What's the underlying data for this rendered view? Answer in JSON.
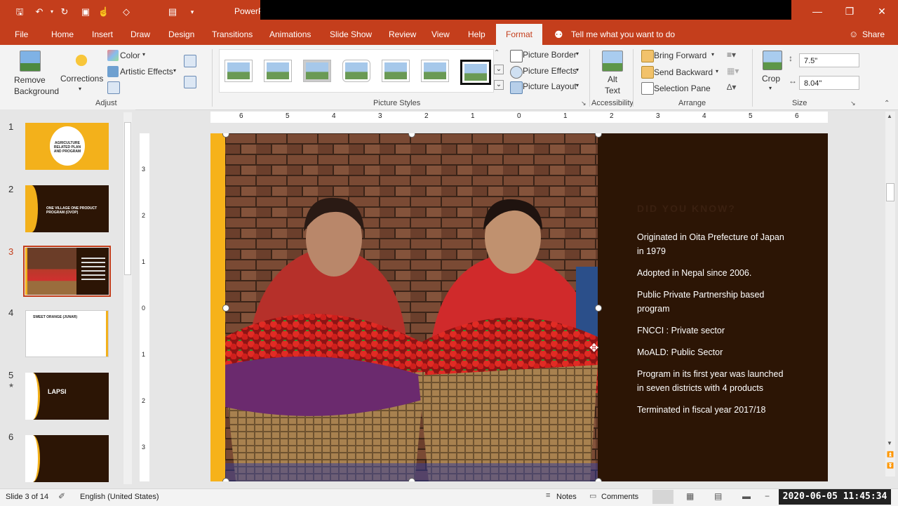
{
  "app": {
    "title": "PowerP"
  },
  "tabs": [
    "File",
    "Home",
    "Insert",
    "Draw",
    "Design",
    "Transitions",
    "Animations",
    "Slide Show",
    "Review",
    "View",
    "Help",
    "Format"
  ],
  "tell_me": "Tell me what you want to do",
  "share": "Share",
  "ribbon": {
    "remove_background": "Remove Background",
    "corrections": "Corrections",
    "color": "Color",
    "artistic_effects": "Artistic Effects",
    "adjust": "Adjust",
    "picture_styles": "Picture Styles",
    "picture_border": "Picture Border",
    "picture_effects": "Picture Effects",
    "picture_layout": "Picture Layout",
    "alt_text": "Alt Text",
    "accessibility": "Accessibility",
    "bring_forward": "Bring Forward",
    "send_backward": "Send Backward",
    "selection_pane": "Selection Pane",
    "arrange": "Arrange",
    "crop": "Crop",
    "height": "7.5\"",
    "width": "8.04\"",
    "size": "Size"
  },
  "ruler_h": [
    "6",
    "5",
    "4",
    "3",
    "2",
    "1",
    "0",
    "1",
    "2",
    "3",
    "4",
    "5",
    "6"
  ],
  "ruler_v": [
    "3",
    "2",
    "1",
    "0",
    "1",
    "2",
    "3"
  ],
  "slides": [
    {
      "num": "1",
      "text": "AGRICULTURE RELATED PLAN AND PROGRAM"
    },
    {
      "num": "2",
      "text": "ONE VILLAGE ONE PRODUCT PROGRAM (OVOP)"
    },
    {
      "num": "3",
      "text": ""
    },
    {
      "num": "4",
      "text": "SWEET ORANGE (JUNAR)"
    },
    {
      "num": "5",
      "text": "LAPSI"
    },
    {
      "num": "6",
      "text": ""
    }
  ],
  "slide_content": {
    "heading": "DID YOU KNOW?",
    "bullets": [
      "Originated in Oita Prefecture of Japan in 1979",
      "Adopted in Nepal since 2006.",
      "Public Private Partnership based program",
      "FNCCI : Private sector",
      "MoALD: Public Sector",
      "Program in its first year was launched in  seven districts with 4 products",
      "Terminated in fiscal year 2017/18"
    ]
  },
  "status": {
    "slide_of": "Slide 3 of 14",
    "language": "English (United States)",
    "notes": "Notes",
    "comments": "Comments",
    "timestamp": "2020-06-05 11:45:34"
  },
  "colors": {
    "accent": "#c43e1c",
    "slide_bg": "#2c1505",
    "strip": "#f6b21a"
  }
}
